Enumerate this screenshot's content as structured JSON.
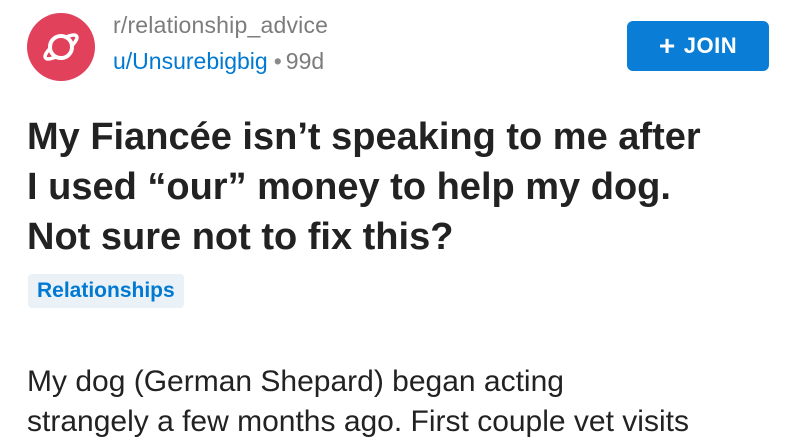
{
  "post": {
    "subreddit": "r/relationship_advice",
    "author": "u/Unsurebigbig",
    "separator": "•",
    "age": "99d",
    "join_label": "JOIN",
    "join_icon": "plus-icon",
    "title_lines": [
      "My Fiancée isn’t speaking to me after",
      "I used “our” money to help my dog.",
      "Not sure not to fix this?"
    ],
    "flair": "Relationships",
    "body_lines": [
      "My dog (German Shepard) began acting",
      "strangely a few months ago. First couple vet visits"
    ]
  },
  "colors": {
    "avatar": "#e2415b",
    "accent": "#0079d3",
    "join_button": "#0a7ed6",
    "flair_bg": "#eaf1f7",
    "muted": "#7c7c7c"
  },
  "icons": {
    "avatar": "planet-icon"
  }
}
